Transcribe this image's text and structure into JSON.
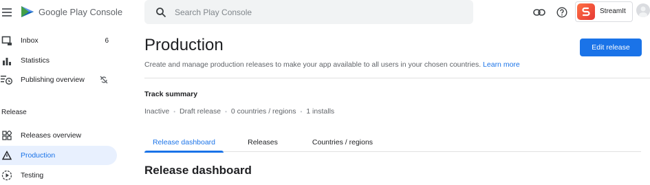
{
  "brand": {
    "name": "Google Play",
    "suffix": "Console"
  },
  "sidebar": {
    "items_top": [
      {
        "label": "Inbox",
        "count": "6",
        "icon": "inbox-icon"
      },
      {
        "label": "Statistics",
        "icon": "bar-chart-icon"
      },
      {
        "label": "Publishing overview",
        "icon": "publishing-icon",
        "trail_icon": "sync-off-icon"
      }
    ],
    "section_label": "Release",
    "items_release": [
      {
        "label": "Releases overview",
        "icon": "grid-icon"
      },
      {
        "label": "Production",
        "icon": "warning-triangle-icon",
        "active": true
      },
      {
        "label": "Testing",
        "icon": "play-circle-icon"
      }
    ]
  },
  "header": {
    "search_placeholder": "Search Play Console",
    "app_name": "StreamIt"
  },
  "main": {
    "title": "Production",
    "description": "Create and manage production releases to make your app available to all users in your chosen countries.",
    "learn_more": "Learn more",
    "edit_button": "Edit release",
    "track_title": "Track summary",
    "track_summary": [
      "Inactive",
      "Draft release",
      "0 countries / regions",
      "1 installs"
    ],
    "tabs": [
      "Release dashboard",
      "Releases",
      "Countries / regions"
    ],
    "active_tab": "Release dashboard",
    "section_title": "Release dashboard"
  },
  "colors": {
    "accent": "#1a73e8",
    "active_bg": "#e8f0fe"
  }
}
